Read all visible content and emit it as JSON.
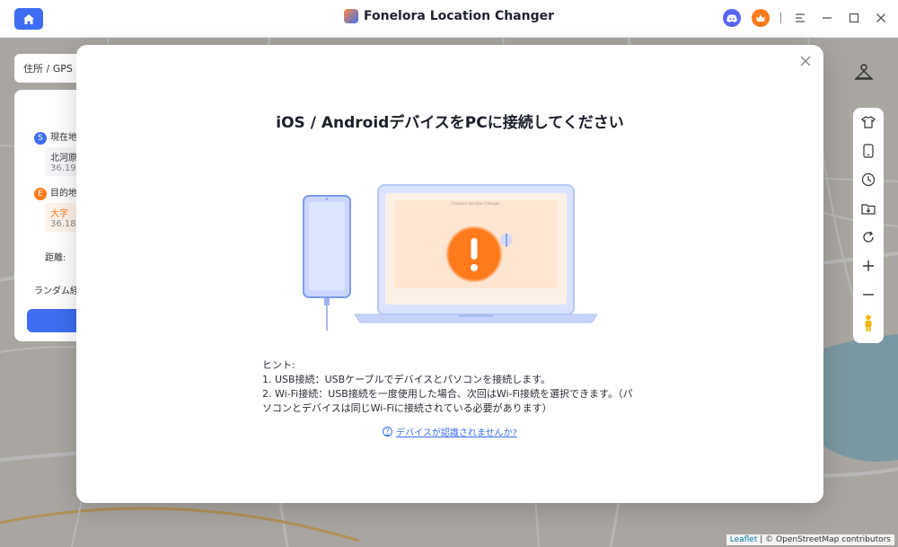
{
  "app": {
    "title": "Fonelora Location Changer"
  },
  "search": {
    "placeholder_text": "住所 / GPS"
  },
  "route_panel": {
    "current_label": "現在地",
    "current_badge": "S",
    "current_place": "北河原",
    "current_coord": "36.19",
    "dest_label": "目的地",
    "dest_badge": "E",
    "dest_place": "大字",
    "dest_coord": "36.18",
    "distance_label": "距離:",
    "random_label": "ランダム経"
  },
  "modal": {
    "title": "iOS / AndroidデバイスをPCに接続してください",
    "hint_heading": "ヒント:",
    "hint_1": "1. USB接続：USBケーブルでデバイスとパソコンを接続します。",
    "hint_2": "2. Wi-Fi接続：USB接続を一度使用した場合、次回はWi-Fi接続を選択できます。（パソコンとデバイスは同じWi-Fiに接続されている必要があります）",
    "help_link": "デバイスが認識されませんか?",
    "laptop_screen_title": "Fonelora Location Changer"
  },
  "map": {
    "attribution_leaflet": "Leaflet",
    "attribution_rest": "| © OpenStreetMap contributors"
  },
  "colors": {
    "accent": "#3d6df2",
    "warning": "#ff7a1a",
    "discord": "#5865f2"
  }
}
